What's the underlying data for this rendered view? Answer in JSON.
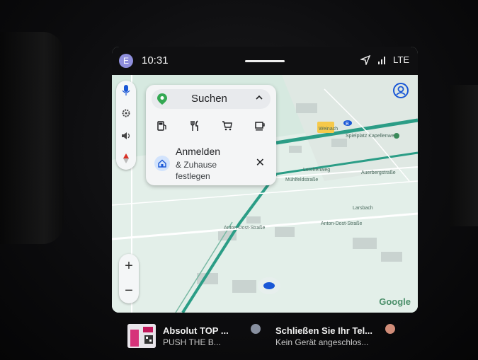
{
  "status_bar": {
    "avatar_letter": "E",
    "time": "10:31",
    "network": "LTE"
  },
  "map": {
    "labels": {
      "place_1": "Spielplatz Kapellenweg",
      "place_2": "Lerchenweg",
      "place_3": "Mühlfeldstraße",
      "place_4": "Auerbergstraße",
      "place_5": "Larsbach",
      "place_6": "Anton-Dost-Straße",
      "place_7": "Anton-Dost-Straße",
      "road_b": "B",
      "shield": "Weinach",
      "logo": "Google"
    }
  },
  "search_card": {
    "search_label": "Suchen",
    "categories": [
      "fuel-icon",
      "restaurant-icon",
      "shopping-icon",
      "coffee-icon"
    ],
    "home_title": "Anmelden",
    "home_subtitle": "& Zuhause festlegen"
  },
  "media": {
    "title": "Absolut TOP ...",
    "subtitle": "PUSH THE B..."
  },
  "phone": {
    "title": "Schließen Sie Ihr Tel...",
    "subtitle": "Kein Gerät angeschlos..."
  },
  "colors": {
    "road_green": "#2b9d86",
    "map_bg": "#d8e8e0",
    "accent_blue": "#1a57d6"
  }
}
